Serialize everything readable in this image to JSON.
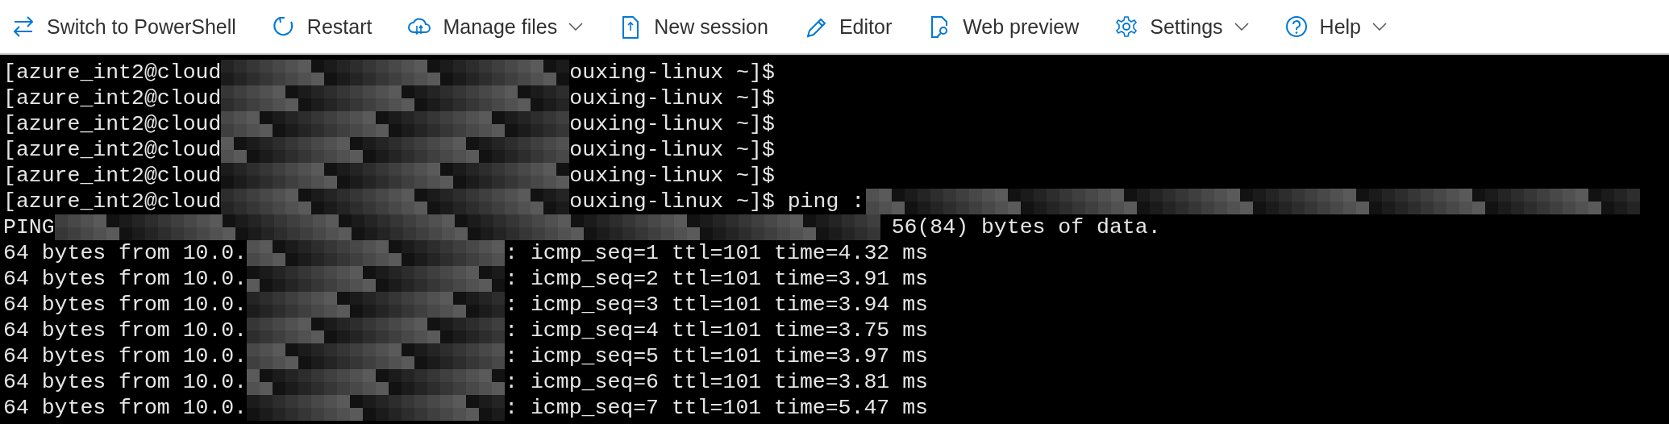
{
  "toolbar": [
    {
      "kind": "switch",
      "label": "Switch to PowerShell",
      "has_menu": false
    },
    {
      "kind": "restart",
      "label": "Restart",
      "has_menu": false
    },
    {
      "kind": "files",
      "label": "Manage files",
      "has_menu": true
    },
    {
      "kind": "session",
      "label": "New session",
      "has_menu": false
    },
    {
      "kind": "editor",
      "label": "Editor",
      "has_menu": false
    },
    {
      "kind": "preview",
      "label": "Web preview",
      "has_menu": false
    },
    {
      "kind": "settings",
      "label": "Settings",
      "has_menu": true
    },
    {
      "kind": "help",
      "label": "Help",
      "has_menu": true
    }
  ],
  "terminal": {
    "lines": [
      {
        "kind": "prompt",
        "segments": [
          {
            "text": "[azure_int2@cloud"
          },
          {
            "kind": "redacted"
          },
          {
            "text": "ouxing-linux ~]$"
          }
        ]
      },
      {
        "kind": "prompt",
        "segments": [
          {
            "text": "[azure_int2@cloud"
          },
          {
            "kind": "redacted"
          },
          {
            "text": "ouxing-linux ~]$"
          }
        ]
      },
      {
        "kind": "prompt",
        "segments": [
          {
            "text": "[azure_int2@cloud"
          },
          {
            "kind": "redacted"
          },
          {
            "text": "ouxing-linux ~]$"
          }
        ]
      },
      {
        "kind": "prompt",
        "segments": [
          {
            "text": "[azure_int2@cloud"
          },
          {
            "kind": "redacted"
          },
          {
            "text": "ouxing-linux ~]$"
          }
        ]
      },
      {
        "kind": "prompt",
        "segments": [
          {
            "text": "[azure_int2@cloud"
          },
          {
            "kind": "redacted"
          },
          {
            "text": "ouxing-linux ~]$"
          }
        ]
      },
      {
        "kind": "command",
        "segments": [
          {
            "text": "[azure_int2@cloud"
          },
          {
            "kind": "redacted"
          },
          {
            "text": "ouxing-linux ~]$ ping :"
          },
          {
            "kind": "redacted"
          }
        ]
      },
      {
        "kind": "header",
        "segments": [
          {
            "text": "PING"
          },
          {
            "kind": "redacted"
          },
          {
            "text": "56(84) bytes of data."
          }
        ]
      },
      {
        "kind": "reply",
        "segments": [
          {
            "text": "64 bytes from 10.0."
          },
          {
            "kind": "redacted"
          },
          {
            "text": ": icmp_seq=1 ttl=101 time=4.32 ms"
          }
        ]
      },
      {
        "kind": "reply",
        "segments": [
          {
            "text": "64 bytes from 10.0."
          },
          {
            "kind": "redacted"
          },
          {
            "text": ": icmp_seq=2 ttl=101 time=3.91 ms"
          }
        ]
      },
      {
        "kind": "reply",
        "segments": [
          {
            "text": "64 bytes from 10.0."
          },
          {
            "kind": "redacted"
          },
          {
            "text": ": icmp_seq=3 ttl=101 time=3.94 ms"
          }
        ]
      },
      {
        "kind": "reply",
        "segments": [
          {
            "text": "64 bytes from 10.0."
          },
          {
            "kind": "redacted"
          },
          {
            "text": ": icmp_seq=4 ttl=101 time=3.75 ms"
          }
        ]
      },
      {
        "kind": "reply",
        "segments": [
          {
            "text": "64 bytes from 10.0."
          },
          {
            "kind": "redacted"
          },
          {
            "text": ": icmp_seq=5 ttl=101 time=3.97 ms"
          }
        ]
      },
      {
        "kind": "reply",
        "segments": [
          {
            "text": "64 bytes from 10.0."
          },
          {
            "kind": "redacted"
          },
          {
            "text": ": icmp_seq=6 ttl=101 time=3.81 ms"
          }
        ]
      },
      {
        "kind": "reply",
        "segments": [
          {
            "text": "64 bytes from 10.0."
          },
          {
            "kind": "redacted"
          },
          {
            "text": ": icmp_seq=7 ttl=101 time=5.47 ms"
          }
        ]
      }
    ]
  }
}
